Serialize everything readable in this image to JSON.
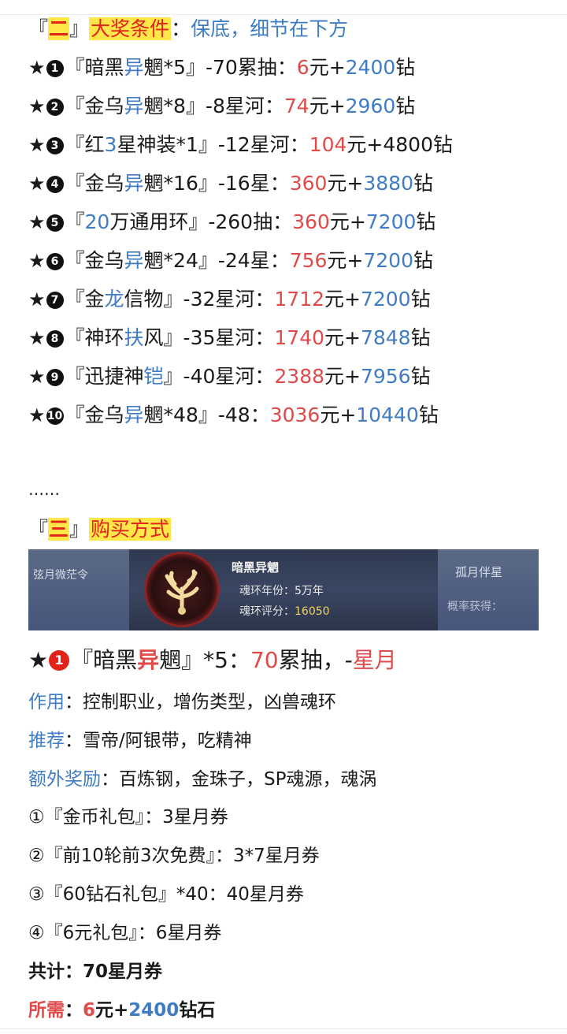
{
  "section2": {
    "lbracket": "『",
    "num": "二",
    "rbracket": "』",
    "title": "大奖条件",
    "colon": "：",
    "note": "保底，细节在下方"
  },
  "rows": [
    {
      "star": "★",
      "badge": "1",
      "p1": "『暗黑",
      "p2": "异",
      "p3": "魍*5』-70累抽：",
      "price": "6",
      "yuan": "元+",
      "diamond": "2400",
      "zuan": "钻"
    },
    {
      "star": "★",
      "badge": "2",
      "p1": "『金乌",
      "p2": "异",
      "p3": "魍*8』-8星河：",
      "price": "74",
      "yuan": "元+",
      "diamond": "2960",
      "zuan": "钻"
    },
    {
      "star": "★",
      "badge": "3",
      "p1": "『红",
      "p2": "3",
      "p3": "星神装*1』-12星河：",
      "price": "104",
      "yuan": "元+4800钻",
      "diamond": "",
      "zuan": ""
    },
    {
      "star": "★",
      "badge": "4",
      "p1": "『金乌",
      "p2": "异",
      "p3": "魍*16』-16星：",
      "price": "360",
      "yuan": "元+",
      "diamond": "3880",
      "zuan": "钻"
    },
    {
      "star": "★",
      "badge": "5",
      "p1": "『",
      "p2": "20",
      "p3": "万通用环』-260抽：",
      "price": "360",
      "yuan": "元+",
      "diamond": "7200",
      "zuan": "钻"
    },
    {
      "star": "★",
      "badge": "6",
      "p1": "『金乌",
      "p2": "异",
      "p3": "魍*24』-24星：",
      "price": "756",
      "yuan": "元+",
      "diamond": "7200",
      "zuan": "钻"
    },
    {
      "star": "★",
      "badge": "7",
      "p1": "『金",
      "p2": "龙",
      "p3": "信物』-32星河：",
      "price": "1712",
      "yuan": "元+",
      "diamond": "7200",
      "zuan": "钻"
    },
    {
      "star": "★",
      "badge": "8",
      "p1": "『神环",
      "p2": "扶",
      "p3": "风』-35星河：",
      "price": "1740",
      "yuan": "元+",
      "diamond": "7848",
      "zuan": "钻"
    },
    {
      "star": "★",
      "badge": "9",
      "p1": "『迅捷神",
      "p2": "铠",
      "p3": "』-40星河：",
      "price": "2388",
      "yuan": "元+",
      "diamond": "7956",
      "zuan": "钻"
    },
    {
      "star": "★",
      "badge": "10",
      "p1": "『金乌",
      "p2": "异",
      "p3": "魍*48』-48：",
      "price": "3036",
      "yuan": "元+",
      "diamond": "10440",
      "zuan": "钻"
    }
  ],
  "ellipsis": "……",
  "section3": {
    "lbracket": "『",
    "num": "三",
    "rbracket": "』",
    "title": "购买方式"
  },
  "banner": {
    "left_text": "弦月微茫令",
    "title": "暗黑异魍",
    "row1_label": "魂环年份：",
    "row1_value": "5万年",
    "row2_label": "魂环评分：",
    "row2_value": "16050",
    "right_title": "孤月伴星",
    "right_sub": "概率获得："
  },
  "detail": {
    "star": "★",
    "badge": "1",
    "pre": "『暗黑",
    "yi": "异",
    "post": "魍』*5：",
    "draws": "70",
    "draws_label": "累抽，-",
    "currency": "星月"
  },
  "info": [
    {
      "label": "作用",
      "colon": "：",
      "text": "控制职业，增伤类型，凶兽魂环"
    },
    {
      "label": "推荐",
      "colon": "：",
      "text": "雪帝/阿银带，吃精神"
    },
    {
      "label": "额外奖励",
      "colon": "：",
      "text": "百炼钢，金珠子，SP魂源，魂涡"
    }
  ],
  "items": [
    "①『金币礼包』：3星月券",
    "②『前10轮前3次免费』：3*7星月券",
    "③『60钻石礼包』*40：40星月券",
    "④『6元礼包』：6星月券"
  ],
  "total": {
    "label": "共计",
    "colon": "：",
    "value": "70星月券"
  },
  "needed": {
    "label": "所需",
    "colon": "：",
    "price": "6",
    "yuan": "元+",
    "diamond": "2400",
    "suffix": "钻石"
  },
  "colors": {
    "red": "#e04a4a",
    "blue": "#3f7cc4",
    "highlight": "#ffe74a"
  }
}
